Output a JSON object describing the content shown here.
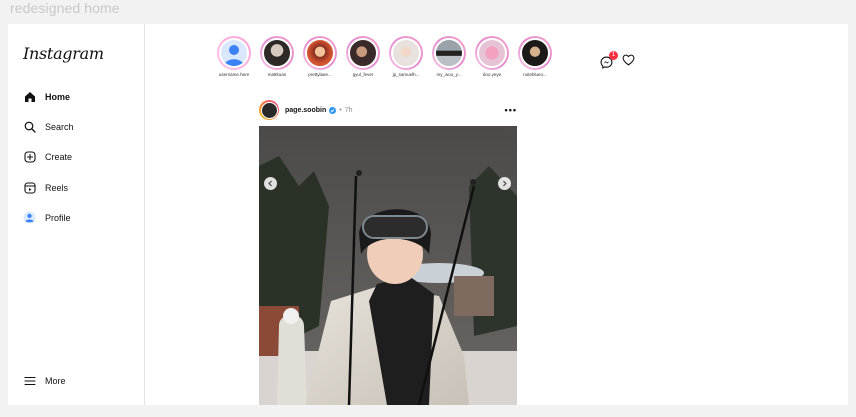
{
  "frame_label": "redesigned home",
  "sidebar": {
    "logo": "Instagram",
    "items": [
      {
        "label": "Home",
        "icon": "home-icon"
      },
      {
        "label": "Search",
        "icon": "search-icon"
      },
      {
        "label": "Create",
        "icon": "create-icon"
      },
      {
        "label": "Reels",
        "icon": "reels-icon"
      },
      {
        "label": "Profile",
        "icon": "profile-icon"
      }
    ],
    "more_label": "More"
  },
  "stories": [
    {
      "name": "username.here"
    },
    {
      "name": "mattkuan"
    },
    {
      "name": "prettylaee..."
    },
    {
      "name": "gyul_fever"
    },
    {
      "name": "jp_samuelh..."
    },
    {
      "name": "my_woo_y..."
    },
    {
      "name": "doo.yeye"
    },
    {
      "name": "noteblueo..."
    }
  ],
  "header": {
    "messages_badge": "1",
    "messages_icon": "messenger-icon",
    "notifications_icon": "heart-icon"
  },
  "post": {
    "username": "page.soobin",
    "separator": "•",
    "time": "7h",
    "more": "•••"
  },
  "colors": {
    "badge": "#ff3040",
    "verified": "#2f96f0",
    "story_ring": "#e48bd0"
  }
}
